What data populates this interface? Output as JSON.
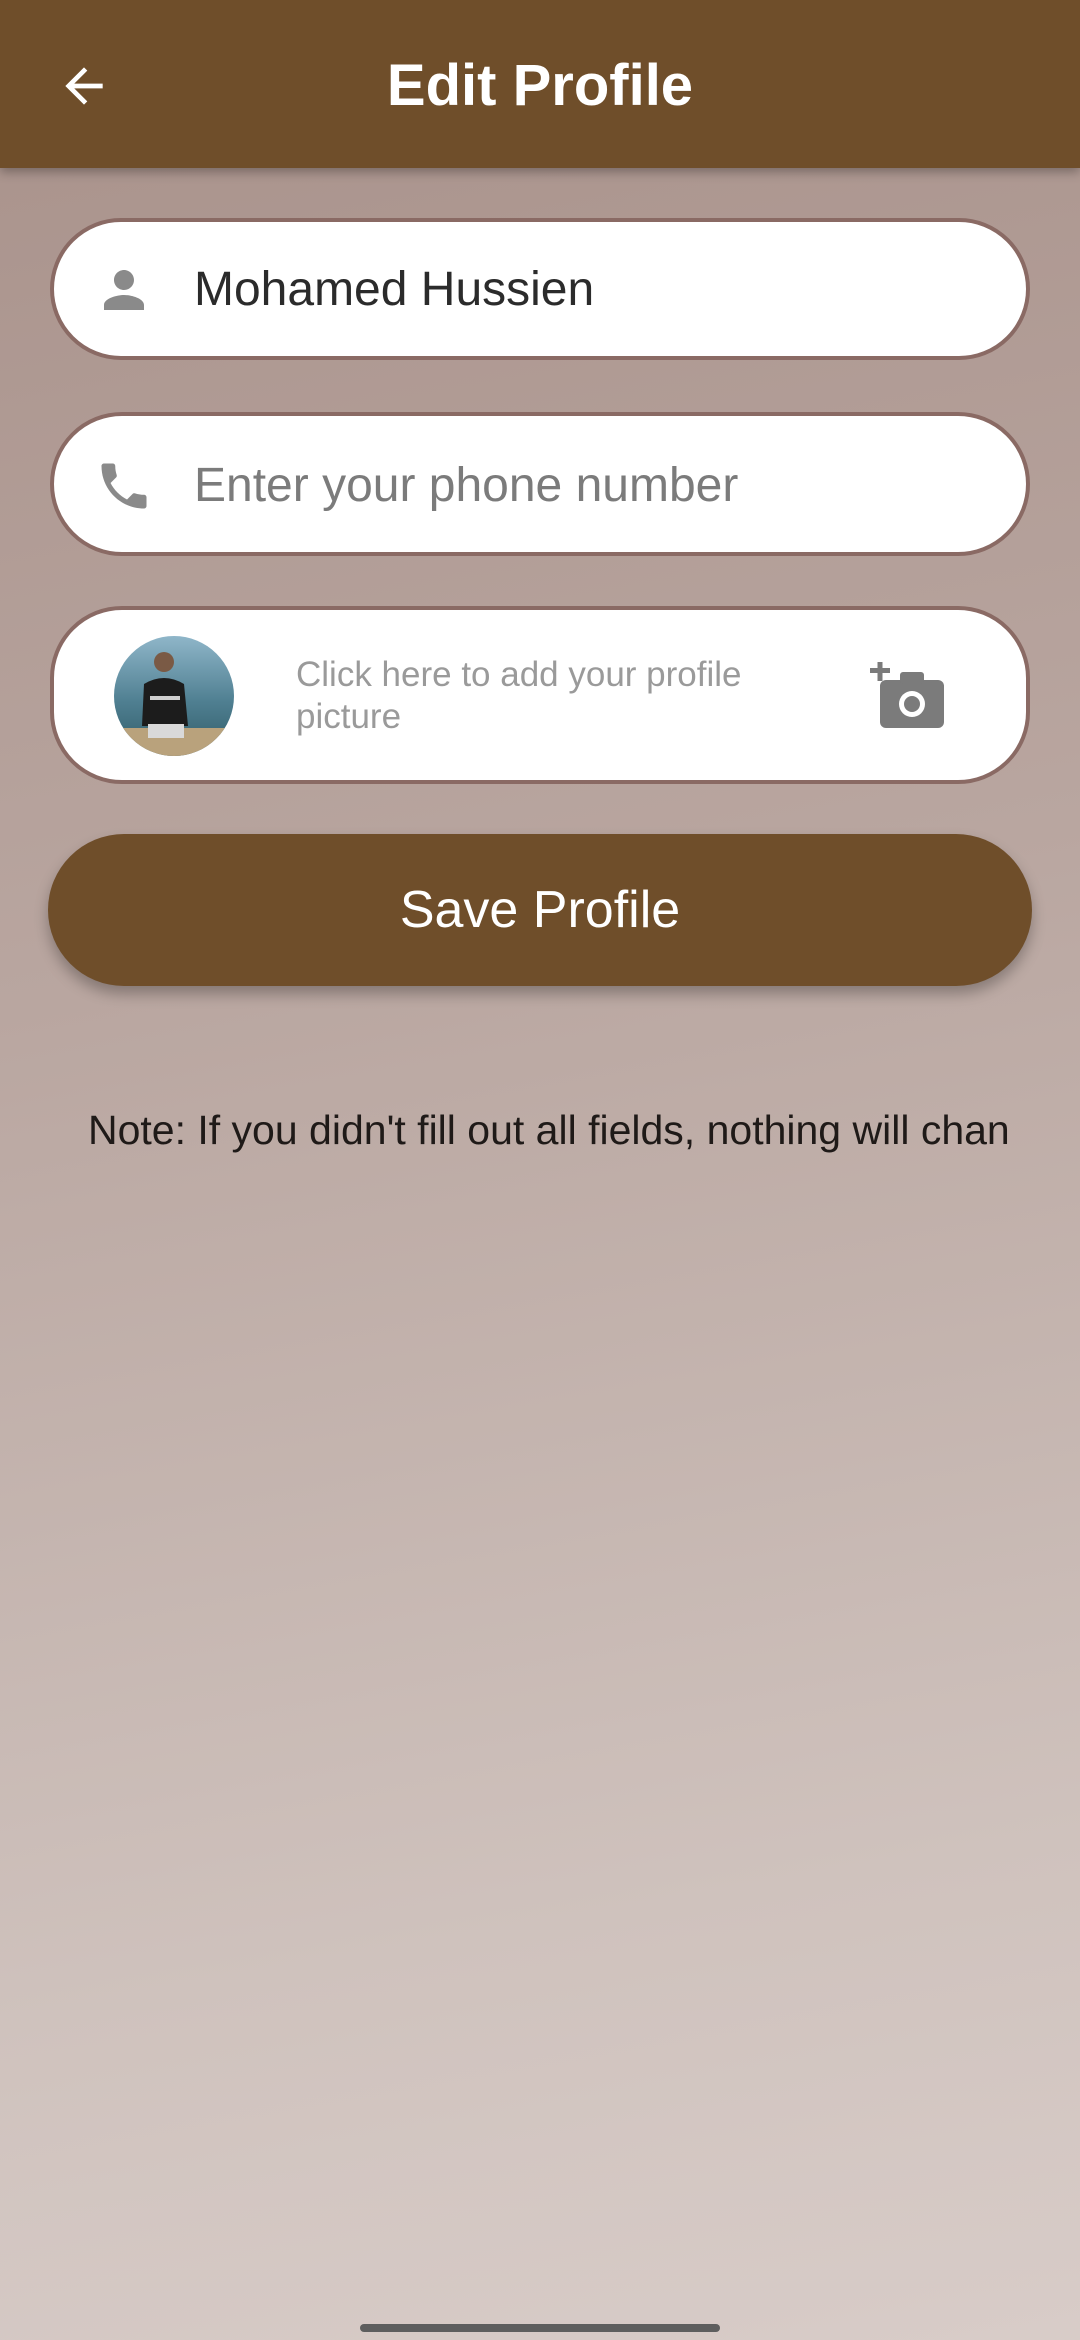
{
  "appbar": {
    "title": "Edit Profile",
    "back_icon": "arrow-back-icon",
    "background": "#6f4e2a"
  },
  "form": {
    "name": {
      "icon": "person-icon",
      "value": "Mohamed Hussien"
    },
    "phone": {
      "icon": "phone-icon",
      "placeholder": "Enter your phone number"
    },
    "picture": {
      "hint": "Click here to add your profile picture",
      "icon": "add-a-photo-icon"
    }
  },
  "save_button": {
    "label": "Save Profile",
    "color": "#6f4e2a"
  },
  "note": "Note: If you didn't fill out all fields, nothing will chan"
}
